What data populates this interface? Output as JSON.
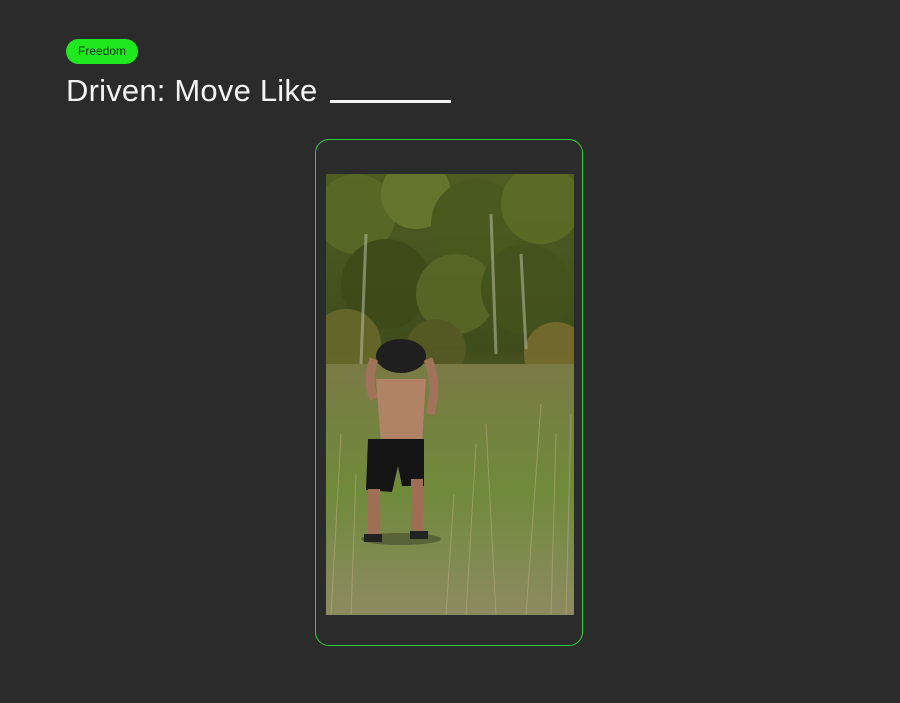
{
  "badge": {
    "label": "Freedom"
  },
  "heading": {
    "title": "Driven: Move Like"
  },
  "colors": {
    "background": "#2b2b2b",
    "accent": "#1fe81f",
    "frame_border": "#2bd13c",
    "text": "#f4f4f4"
  },
  "media": {
    "type": "video-frame"
  }
}
